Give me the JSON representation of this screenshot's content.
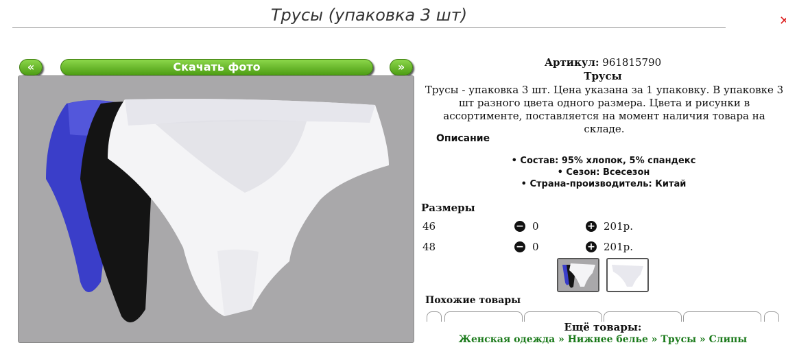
{
  "page_title": "Трусы (упаковка 3 шт)",
  "gallery": {
    "prev_label": "«",
    "download_label": "Скачать фото",
    "next_label": "»"
  },
  "product": {
    "article_label": "Артикул:",
    "article_value": "961815790",
    "name": "Трусы",
    "description": "Трусы - упаковка 3 шт. Цена указана за 1 упаковку. В упаковке 3 шт разного цвета одного размера. Цвета и рисунки в ассортименте, поставляется на момент наличия товара на складе."
  },
  "specs": {
    "title": "Описание",
    "items": [
      "Состав: 95% хлопок, 5% спандекс",
      "Сезон: Всесезон",
      "Страна-производитель: Китай"
    ]
  },
  "sizes": {
    "title": "Размеры",
    "rows": [
      {
        "size": "46",
        "quantity": "0",
        "price": "201р."
      },
      {
        "size": "48",
        "quantity": "0",
        "price": "201р."
      }
    ]
  },
  "similar": {
    "title": "Похожие товары"
  },
  "more": {
    "title": "Ещё товары:",
    "breadcrumb": [
      "Женская одежда",
      "Нижнее белье",
      "Трусы",
      "Слипы"
    ],
    "separator": "»"
  },
  "colors": {
    "accent_green": "#5aae1e",
    "link_green": "#1b7a1b",
    "photo_bg": "#a9a8aa",
    "corner_icon": "#dd2222"
  }
}
